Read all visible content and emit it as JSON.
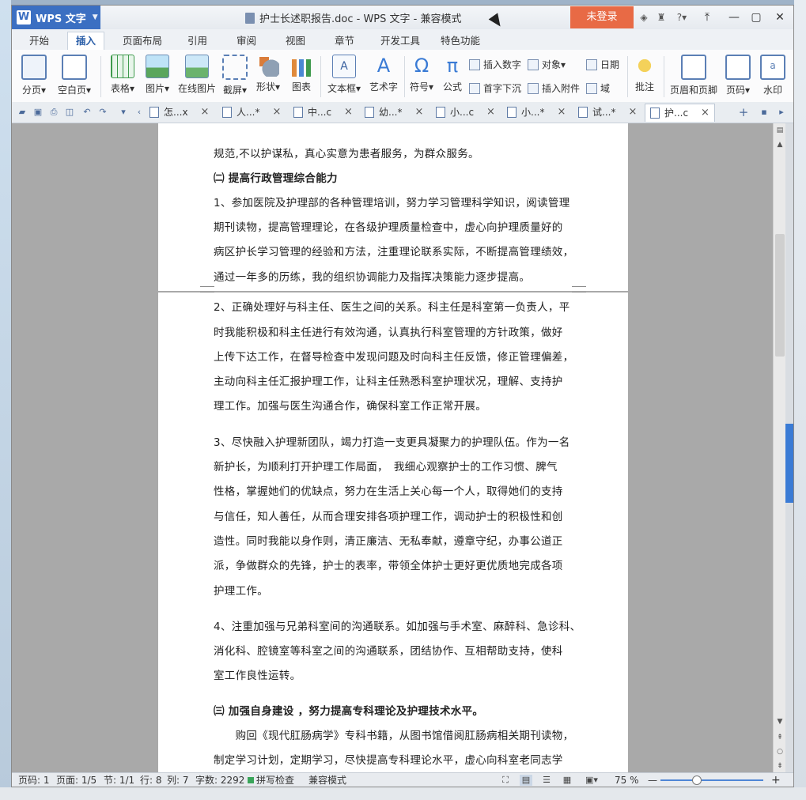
{
  "titlebar": {
    "app_name": "WPS 文字",
    "logo_letter": "W",
    "doc_title": "护士长述职报告.doc - WPS 文字 - 兼容模式",
    "login_label": "未登录",
    "help_label": "?",
    "controls": {
      "restore_down": "⤒",
      "minimize": "—",
      "maximize": "▢",
      "close": "✕"
    }
  },
  "menu_tabs": [
    "开始",
    "插入",
    "页面布局",
    "引用",
    "审阅",
    "视图",
    "章节",
    "开发工具",
    "特色功能"
  ],
  "active_menu_tab": "插入",
  "ribbon": {
    "page_break": "分页",
    "blank_page": "空白页",
    "table": "表格",
    "picture": "图片",
    "online_picture": "在线图片",
    "screenshot": "截屏",
    "shape": "形状",
    "chart": "图表",
    "textbox": "文本框",
    "wordart": "艺术字",
    "symbol": "符号",
    "formula": "公式",
    "insert_number": "插入数字",
    "object": "对象",
    "drop_cap": "首字下沉",
    "attachment": "插入附件",
    "date": "日期",
    "field": "域",
    "comment": "批注",
    "header_footer": "页眉和页脚",
    "page_number": "页码",
    "watermark": "水印"
  },
  "doc_tabs": [
    {
      "label": "怎...x"
    },
    {
      "label": "人...*"
    },
    {
      "label": "中...c"
    },
    {
      "label": "幼...*"
    },
    {
      "label": "小...c"
    },
    {
      "label": "小...*"
    },
    {
      "label": "试...*"
    },
    {
      "label": "护...c"
    }
  ],
  "document": {
    "lines": [
      "规范,不以护谋私，真心实意为患者服务，为群众服务。",
      "㈡ 提高行政管理综合能力",
      "1、参加医院及护理部的各种管理培训，努力学习管理科学知识，阅读管理",
      "期刊读物，提高管理理论，在各级护理质量检查中，虚心向护理质量好的",
      "病区护长学习管理的经验和方法，注重理论联系实际，不断提高管理绩效，",
      "通过一年多的历练，我的组织协调能力及指挥决策能力逐步提高。",
      "2、正确处理好与科主任、医生之间的关系。科主任是科室第一负责人，平",
      "时我能积极和科主任进行有效沟通，认真执行科室管理的方针政策，做好",
      "上传下达工作，在督导检查中发现问题及时向科主任反馈，修正管理偏差，",
      "主动向科主任汇报护理工作，让科主任熟悉科室护理状况，理解、支持护",
      "理工作。加强与医生沟通合作，确保科室工作正常开展。",
      "3、尽快融入护理新团队，竭力打造一支更具凝聚力的护理队伍。作为一名",
      "新护长，为顺利打开护理工作局面，　我细心观察护士的工作习惯、脾气",
      "性格，掌握她们的优缺点，努力在生活上关心每一个人，取得她们的支持",
      "与信任，知人善任，从而合理安排各项护理工作，调动护士的积极性和创",
      "造性。同时我能以身作则，清正廉洁、无私奉献，遵章守纪，办事公道正",
      "派，争做群众的先锋，护士的表率，带领全体护士更好更优质地完成各项",
      "护理工作。",
      "4、注重加强与兄弟科室间的沟通联系。如加强与手术室、麻醉科、急诊科、",
      "消化科、腔镜室等科室之间的沟通联系，团结协作、互相帮助支持，使科",
      "室工作良性运转。",
      "㈢ 加强自身建设 ，努力提高专科理论及护理技术水平。",
      "　　购回《现代肛肠病学》专科书籍，从图书馆借阅肛肠病相关期刊读物，",
      "制定学习计划，定期学习，尽快提高专科理论水平，虚心向科室老同志学"
    ]
  },
  "statusbar": {
    "page_num": "页码: 1",
    "pages": "页面: 1/5",
    "section": "节: 1/1",
    "row": "行: 8",
    "col": "列: 7",
    "word_count": "字数: 2292",
    "spell_check": "拼写检查",
    "compat_mode": "兼容模式",
    "zoom": "75 %",
    "zoom_minus": "—",
    "zoom_plus": "+"
  }
}
